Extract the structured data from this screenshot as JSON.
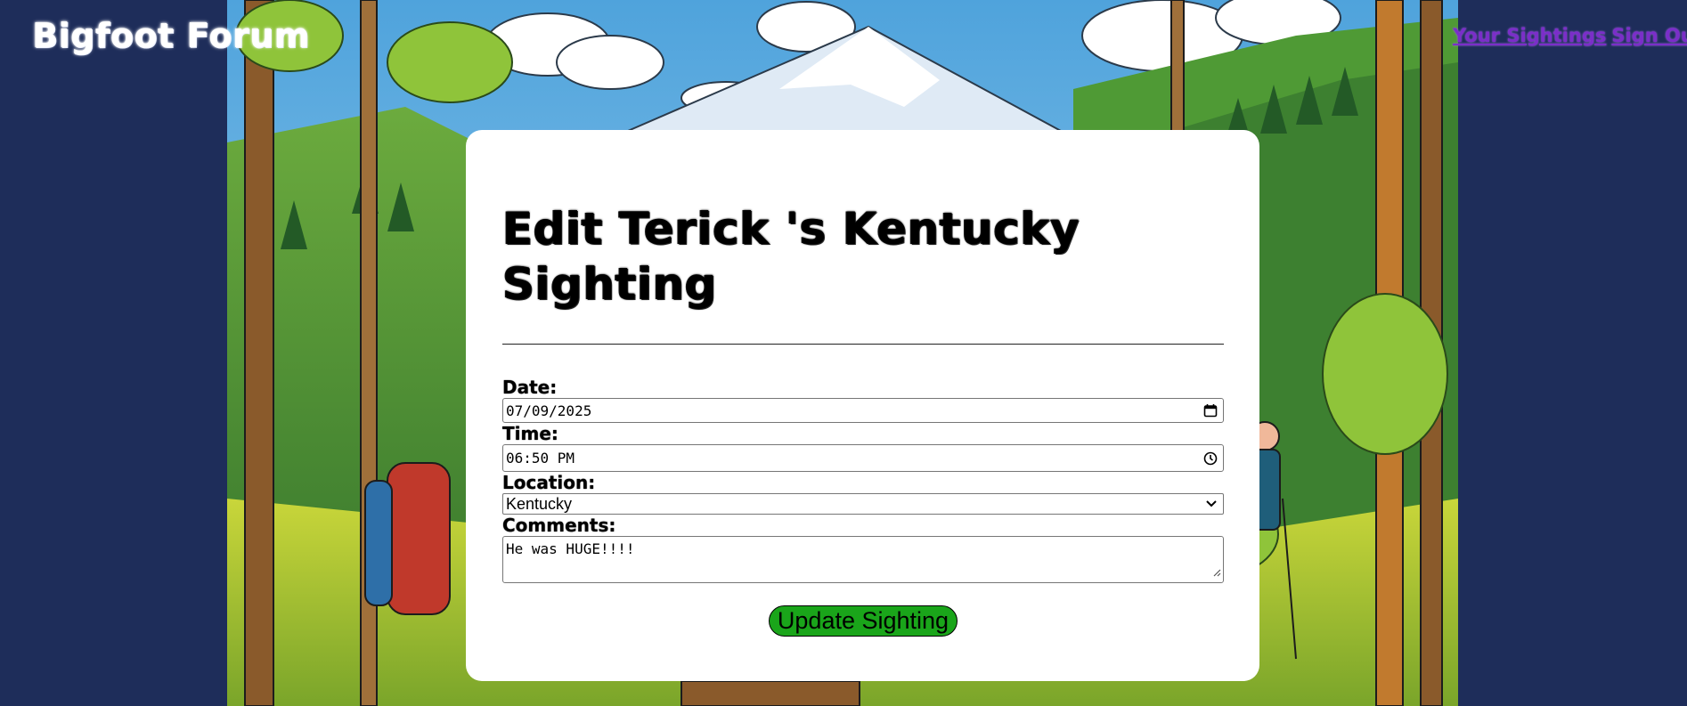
{
  "header": {
    "brand": "Bigfoot Forum",
    "nav": [
      {
        "label": "Your Sightings"
      },
      {
        "label": "Sign Out"
      }
    ],
    "nav_color": "#7b2ec9",
    "background": "#1e2d5a"
  },
  "form": {
    "title": "Edit Terick 's Kentucky Sighting",
    "date_label": "Date:",
    "date_value": "07/09/2025",
    "time_label": "Time:",
    "time_value": "06:50 PM",
    "location_label": "Location:",
    "location_value": "Kentucky",
    "comments_label": "Comments:",
    "comments_value": "He was HUGE!!!!",
    "submit_label": "Update Sighting",
    "submit_color": "#1aa51a"
  },
  "icons": {
    "date": "calendar-icon",
    "time": "clock-icon",
    "location": "chevron-down-icon",
    "comments": "resize-grip-icon"
  }
}
